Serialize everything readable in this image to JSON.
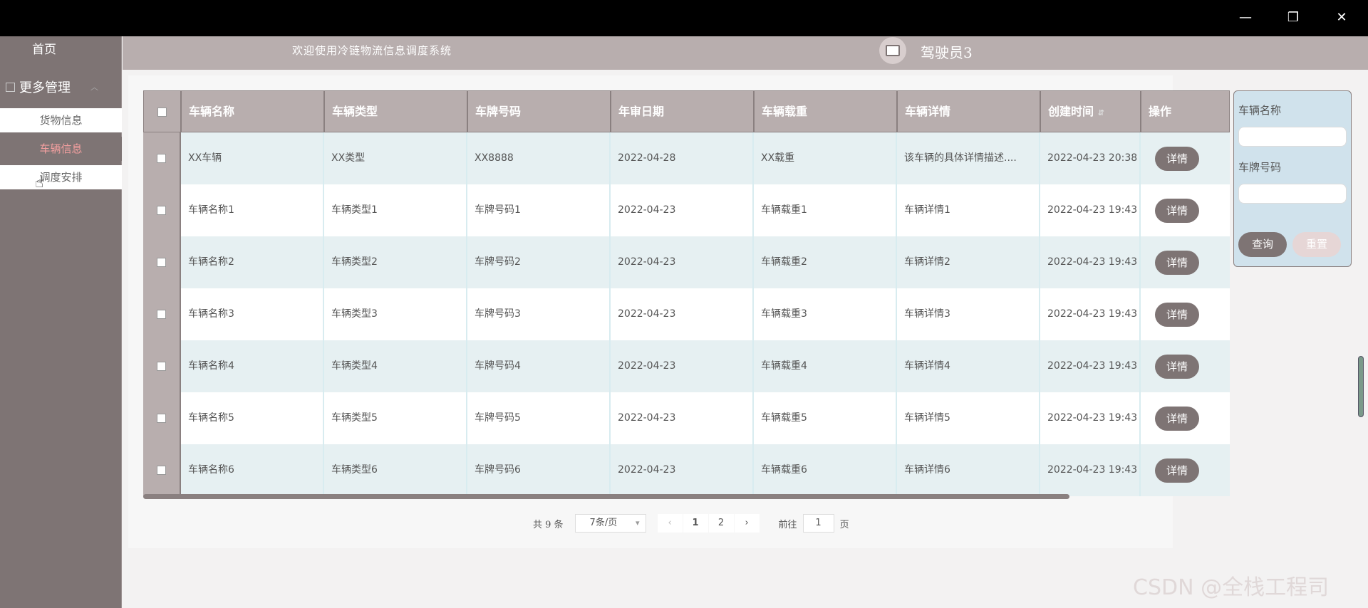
{
  "window": {
    "minimize": "—",
    "restore": "❐",
    "close": "✕"
  },
  "sidebar": {
    "home": "首页",
    "group": "更多管理",
    "items": [
      {
        "label": "货物信息"
      },
      {
        "label": "车辆信息"
      },
      {
        "label": "调度安排"
      }
    ]
  },
  "header": {
    "welcome": "欢迎使用冷链物流信息调度系统",
    "username": "驾驶员3"
  },
  "table": {
    "columns": [
      "车辆名称",
      "车辆类型",
      "车牌号码",
      "年审日期",
      "车辆载重",
      "车辆详情",
      "创建时间",
      "操作"
    ],
    "sort_icon": "⇵",
    "detail_label": "详情",
    "rows": [
      [
        "XX车辆",
        "XX类型",
        "XX8888",
        "2022-04-28",
        "XX载重",
        "该车辆的具体详情描述....",
        "2022-04-23 20:38"
      ],
      [
        "车辆名称1",
        "车辆类型1",
        "车牌号码1",
        "2022-04-23",
        "车辆载重1",
        "车辆详情1",
        "2022-04-23 19:43"
      ],
      [
        "车辆名称2",
        "车辆类型2",
        "车牌号码2",
        "2022-04-23",
        "车辆载重2",
        "车辆详情2",
        "2022-04-23 19:43"
      ],
      [
        "车辆名称3",
        "车辆类型3",
        "车牌号码3",
        "2022-04-23",
        "车辆载重3",
        "车辆详情3",
        "2022-04-23 19:43"
      ],
      [
        "车辆名称4",
        "车辆类型4",
        "车牌号码4",
        "2022-04-23",
        "车辆载重4",
        "车辆详情4",
        "2022-04-23 19:43"
      ],
      [
        "车辆名称5",
        "车辆类型5",
        "车牌号码5",
        "2022-04-23",
        "车辆载重5",
        "车辆详情5",
        "2022-04-23 19:43"
      ],
      [
        "车辆名称6",
        "车辆类型6",
        "车牌号码6",
        "2022-04-23",
        "车辆载重6",
        "车辆详情6",
        "2022-04-23 19:43"
      ]
    ]
  },
  "search": {
    "name_label": "车辆名称",
    "plate_label": "车牌号码",
    "query": "查询",
    "reset": "重置"
  },
  "pagination": {
    "total": "共 9 条",
    "page_size": "7条/页",
    "prev": "‹",
    "pages": [
      "1",
      "2"
    ],
    "next": "›",
    "goto": "前往",
    "goto_value": "1",
    "page_suffix": "页"
  },
  "watermark": "CSDN @全栈工程司"
}
